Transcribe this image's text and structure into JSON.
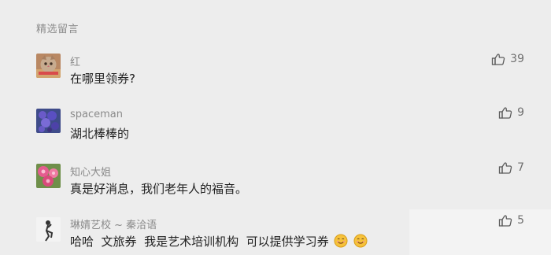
{
  "section": {
    "title": "精选留言"
  },
  "comments": [
    {
      "author": "红",
      "content": "在哪里领券?",
      "likes": "39",
      "avatar_icon": "cat-avatar-icon"
    },
    {
      "author": "spaceman",
      "content": "湖北棒棒的",
      "likes": "9",
      "avatar_icon": "flower-avatar-icon"
    },
    {
      "author": "知心大姐",
      "content": "真是好消息，我们老年人的福音。",
      "likes": "7",
      "avatar_icon": "rose-avatar-icon"
    },
    {
      "author": "琳婧艺校 ~ 秦洽语",
      "content": "哈哈  文旅券  我是艺术培训机构  可以提供学习券",
      "likes": "5",
      "avatar_icon": "dancer-avatar-icon"
    }
  ],
  "colors": {
    "background": "#ededed",
    "author": "#8a8a8a",
    "content": "#222222",
    "like_icon": "#5b5b5b"
  }
}
